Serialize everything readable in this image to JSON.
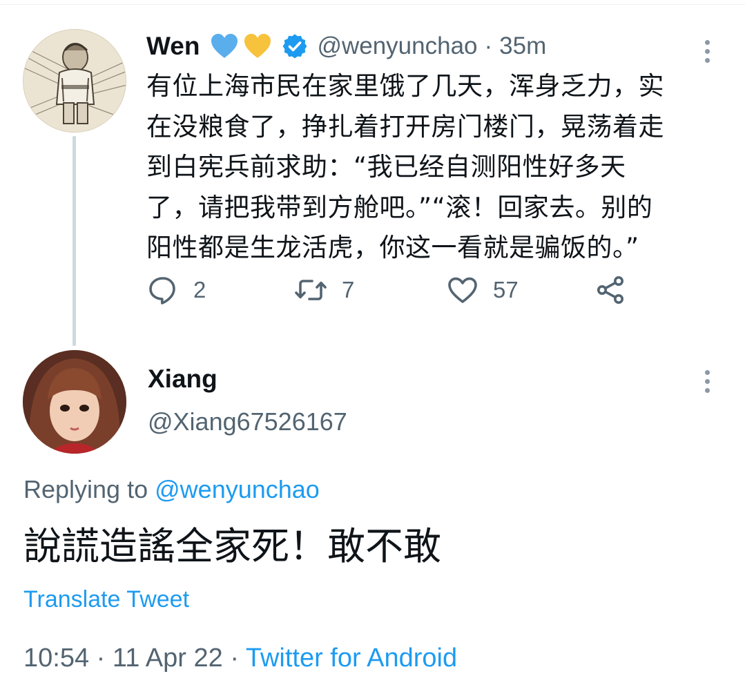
{
  "original_tweet": {
    "author_name": "Wen",
    "author_emojis": [
      "blue-heart-emoji",
      "yellow-heart-emoji"
    ],
    "verified": true,
    "handle": "@wenyunchao",
    "separator": "·",
    "time_ago": "35m",
    "text_lines": [
      "有位上海市民在家里饿了几天，浑身乏力，实",
      "在没粮食了，挣扎着打开房门楼门，晃荡着走",
      "到白宪兵前求助：“我已经自测阳性好多天",
      "了，请把我带到方舱吧。”“滚！回家去。别的",
      "阳性都是生龙活虎，你这一看就是骗饭的。”"
    ],
    "actions": {
      "reply_count": "2",
      "retweet_count": "7",
      "like_count": "57"
    },
    "colors": {
      "blue_heart": "#5aaeec",
      "yellow_heart": "#f7c23c",
      "verified_badge": "#1d9bf0",
      "icon_gray": "#536471"
    }
  },
  "reply_tweet": {
    "author_name": "Xiang",
    "handle": "@Xiang67526167",
    "replying_prefix": "Replying to",
    "replying_to": "@wenyunchao",
    "text": "說謊造謠全家死！敢不敢",
    "translate_label": "Translate Tweet",
    "time": "10:54",
    "separator_1": "·",
    "date": "11 Apr 22",
    "separator_2": "·",
    "source": "Twitter for Android"
  },
  "accent_color": "#1d9bf0"
}
